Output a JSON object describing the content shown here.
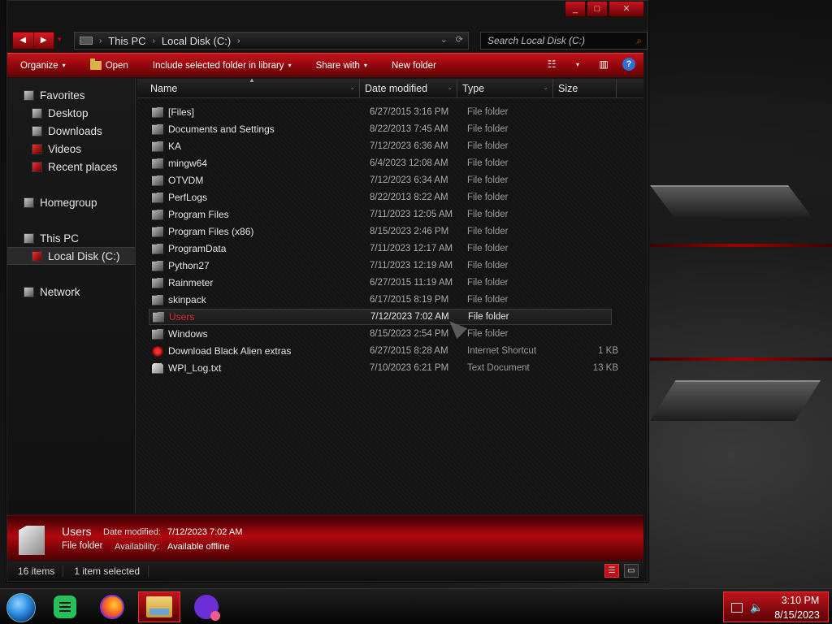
{
  "window": {
    "caption_buttons": [
      "_",
      "□",
      "✕"
    ]
  },
  "nav_buttons": {
    "back": "◀",
    "forward": "▶",
    "history": "▾"
  },
  "address": {
    "crumbs": [
      "This PC",
      "Local Disk (C:)"
    ],
    "separator": "›",
    "dropdown": "⌄",
    "refresh": "⟳"
  },
  "search": {
    "placeholder": "Search Local Disk (C:)",
    "icon": "⌕"
  },
  "toolbar": {
    "organize": "Organize",
    "open": "Open",
    "include": "Include selected folder in library",
    "share": "Share with",
    "new_folder": "New folder",
    "caret": "▾",
    "view_icon": "☷",
    "pane_icon": "▥",
    "help": "?"
  },
  "sidebar": {
    "favorites": "Favorites",
    "desktop": "Desktop",
    "downloads": "Downloads",
    "videos": "Videos",
    "recent": "Recent places",
    "homegroup": "Homegroup",
    "this_pc": "This PC",
    "local_disk": "Local Disk (C:)",
    "network": "Network"
  },
  "columns": {
    "name": "Name",
    "date": "Date modified",
    "type": "Type",
    "size": "Size",
    "sort_arrow": "▲",
    "col_arrow": "⌄"
  },
  "files": [
    {
      "name": "[Files]",
      "date": "6/27/2015 3:16 PM",
      "type": "File folder",
      "size": ""
    },
    {
      "name": "Documents and Settings",
      "date": "8/22/2013 7:45 AM",
      "type": "File folder",
      "size": ""
    },
    {
      "name": "KA",
      "date": "7/12/2023 6:36 AM",
      "type": "File folder",
      "size": ""
    },
    {
      "name": "mingw64",
      "date": "6/4/2023 12:08 AM",
      "type": "File folder",
      "size": ""
    },
    {
      "name": "OTVDM",
      "date": "7/12/2023 6:34 AM",
      "type": "File folder",
      "size": ""
    },
    {
      "name": "PerfLogs",
      "date": "8/22/2013 8:22 AM",
      "type": "File folder",
      "size": ""
    },
    {
      "name": "Program Files",
      "date": "7/11/2023 12:05 AM",
      "type": "File folder",
      "size": ""
    },
    {
      "name": "Program Files (x86)",
      "date": "8/15/2023 2:46 PM",
      "type": "File folder",
      "size": ""
    },
    {
      "name": "ProgramData",
      "date": "7/11/2023 12:17 AM",
      "type": "File folder",
      "size": ""
    },
    {
      "name": "Python27",
      "date": "7/11/2023 12:19 AM",
      "type": "File folder",
      "size": ""
    },
    {
      "name": "Rainmeter",
      "date": "6/27/2015 11:19 AM",
      "type": "File folder",
      "size": ""
    },
    {
      "name": "skinpack",
      "date": "6/17/2015 8:19 PM",
      "type": "File folder",
      "size": ""
    },
    {
      "name": "Users",
      "date": "7/12/2023 7:02 AM",
      "type": "File folder",
      "size": ""
    },
    {
      "name": "Windows",
      "date": "8/15/2023 2:54 PM",
      "type": "File folder",
      "size": ""
    },
    {
      "name": "Download Black Alien extras",
      "date": "6/27/2015 8:28 AM",
      "type": "Internet Shortcut",
      "size": "1 KB"
    },
    {
      "name": "WPI_Log.txt",
      "date": "7/10/2023 6:21 PM",
      "type": "Text Document",
      "size": "13 KB"
    }
  ],
  "details": {
    "name": "Users",
    "kind": "File folder",
    "date_label": "Date modified:",
    "date_value": "7/12/2023 7:02 AM",
    "avail_label": "Availability:",
    "avail_value": "Available offline"
  },
  "status": {
    "count": "16 items",
    "selected": "1 item selected",
    "details_view": "☰",
    "thumb_view": "▭"
  },
  "taskbar": {
    "time": "3:10 PM",
    "date": "8/15/2023",
    "volume_icon": "🔈"
  },
  "colors": {
    "accent": "#c3141a",
    "accent_dark": "#5c0306",
    "selected_text": "#e0262c"
  }
}
